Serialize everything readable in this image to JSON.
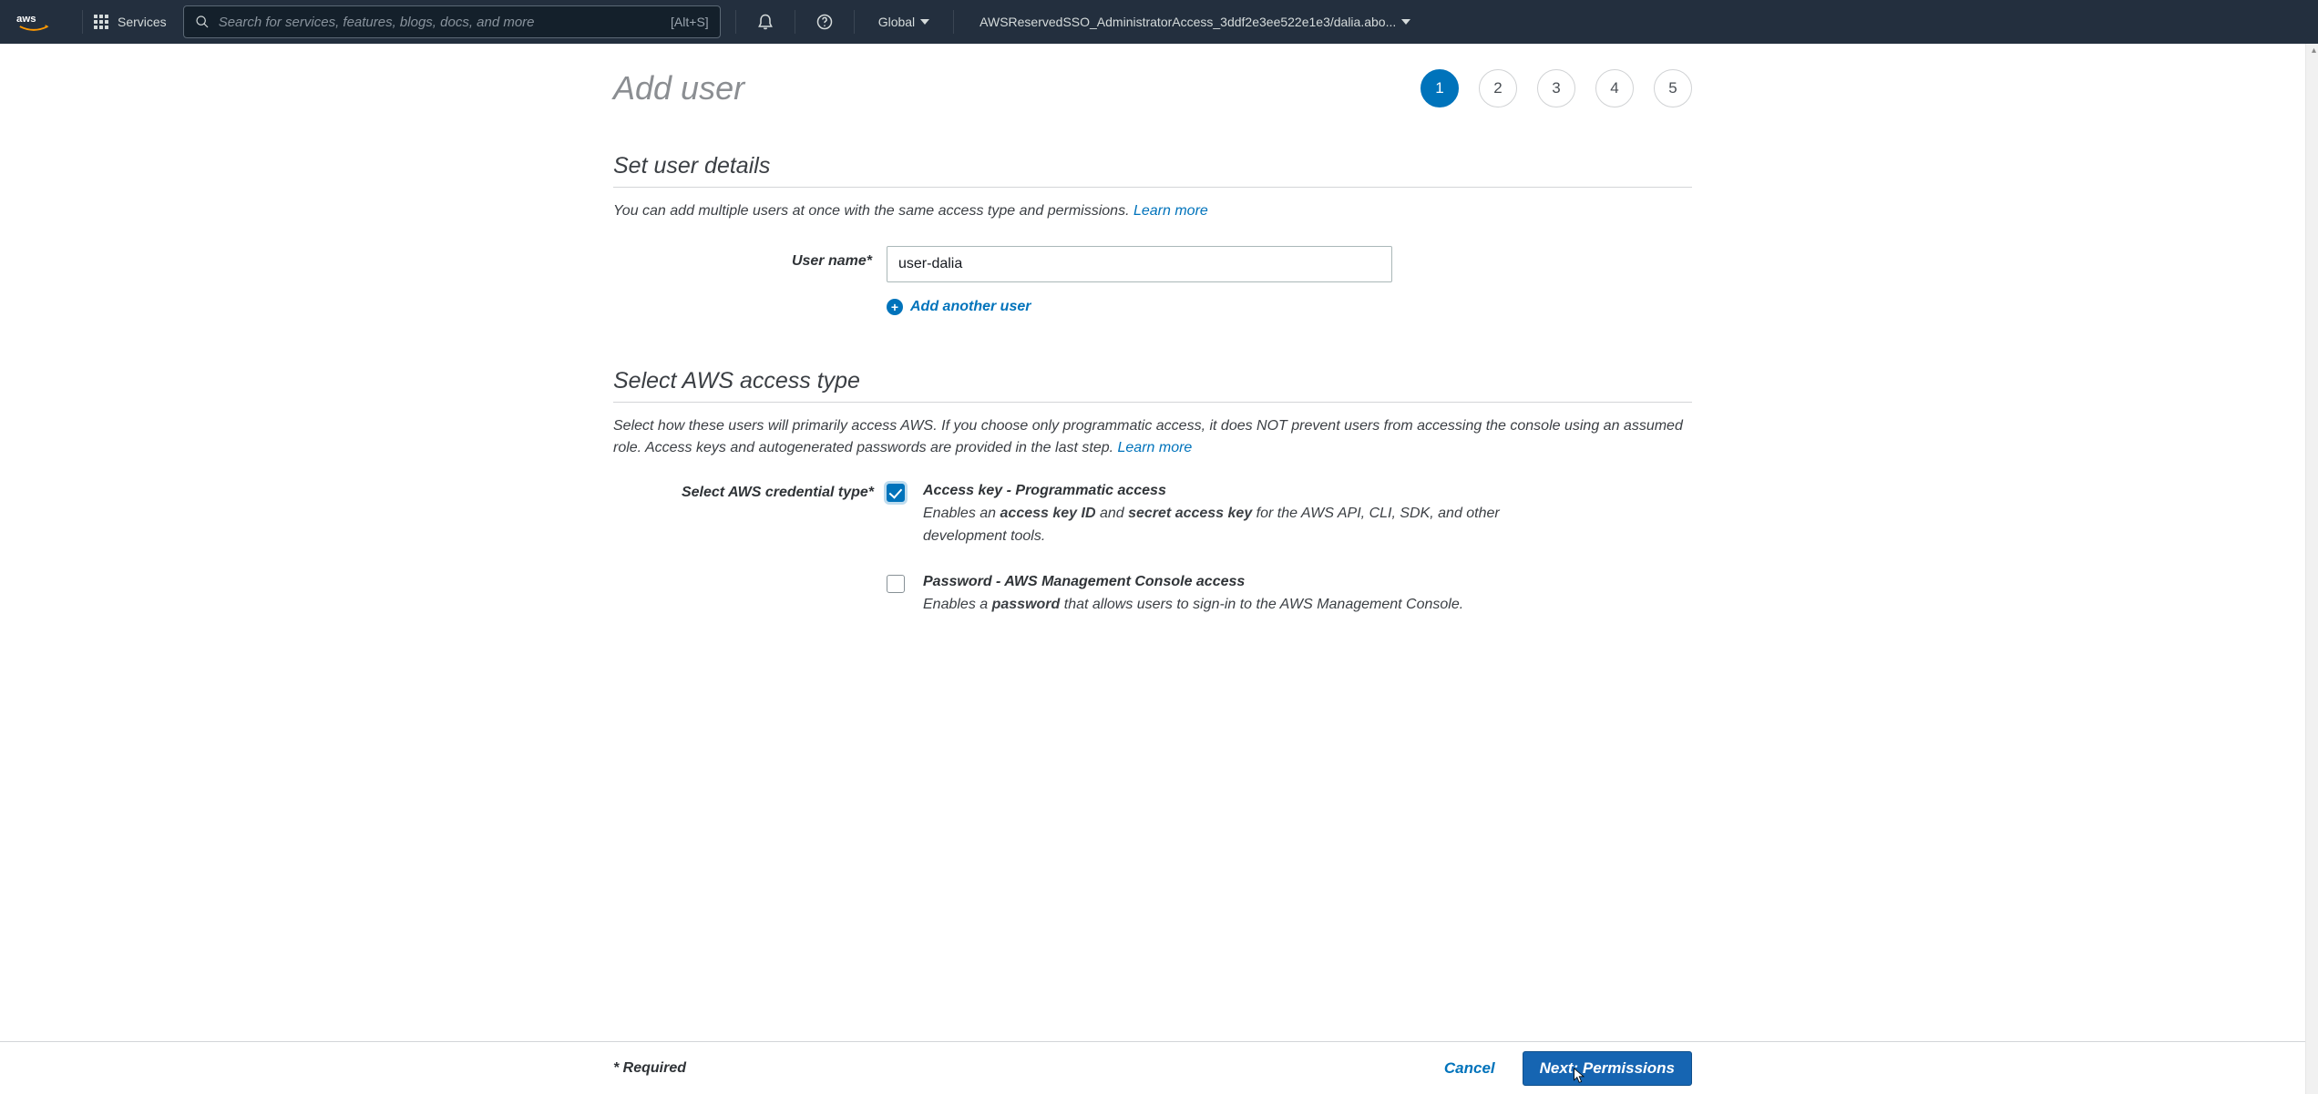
{
  "nav": {
    "services_label": "Services",
    "search_placeholder": "Search for services, features, blogs, docs, and more",
    "search_shortcut": "[Alt+S]",
    "region": "Global",
    "account": "AWSReservedSSO_AdministratorAccess_3ddf2e3ee522e1e3/dalia.abo..."
  },
  "page": {
    "title": "Add user",
    "steps": [
      "1",
      "2",
      "3",
      "4",
      "5"
    ],
    "active_step": 0
  },
  "set_user": {
    "heading": "Set user details",
    "desc": "You can add multiple users at once with the same access type and permissions. ",
    "learn_more": "Learn more",
    "username_label": "User name*",
    "username_value": "user-dalia",
    "add_another": "Add another user"
  },
  "access": {
    "heading": "Select AWS access type",
    "desc_a": "Select how these users will primarily access AWS. If you choose only programmatic access, it does NOT prevent users from accessing the console using an assumed role. Access keys and autogenerated passwords are provided in the last step. ",
    "learn_more": "Learn more",
    "cred_label": "Select AWS credential type*",
    "opt1": {
      "checked": true,
      "title": "Access key - Programmatic access",
      "desc_pre": "Enables an ",
      "desc_b1": "access key ID",
      "desc_mid": " and ",
      "desc_b2": "secret access key",
      "desc_post": " for the AWS API, CLI, SDK, and other development tools."
    },
    "opt2": {
      "checked": false,
      "title": "Password - AWS Management Console access",
      "desc_pre": "Enables a ",
      "desc_b1": "password",
      "desc_post": " that allows users to sign-in to the AWS Management Console."
    }
  },
  "footer": {
    "required": "* Required",
    "cancel": "Cancel",
    "next": "Next: Permissions"
  }
}
